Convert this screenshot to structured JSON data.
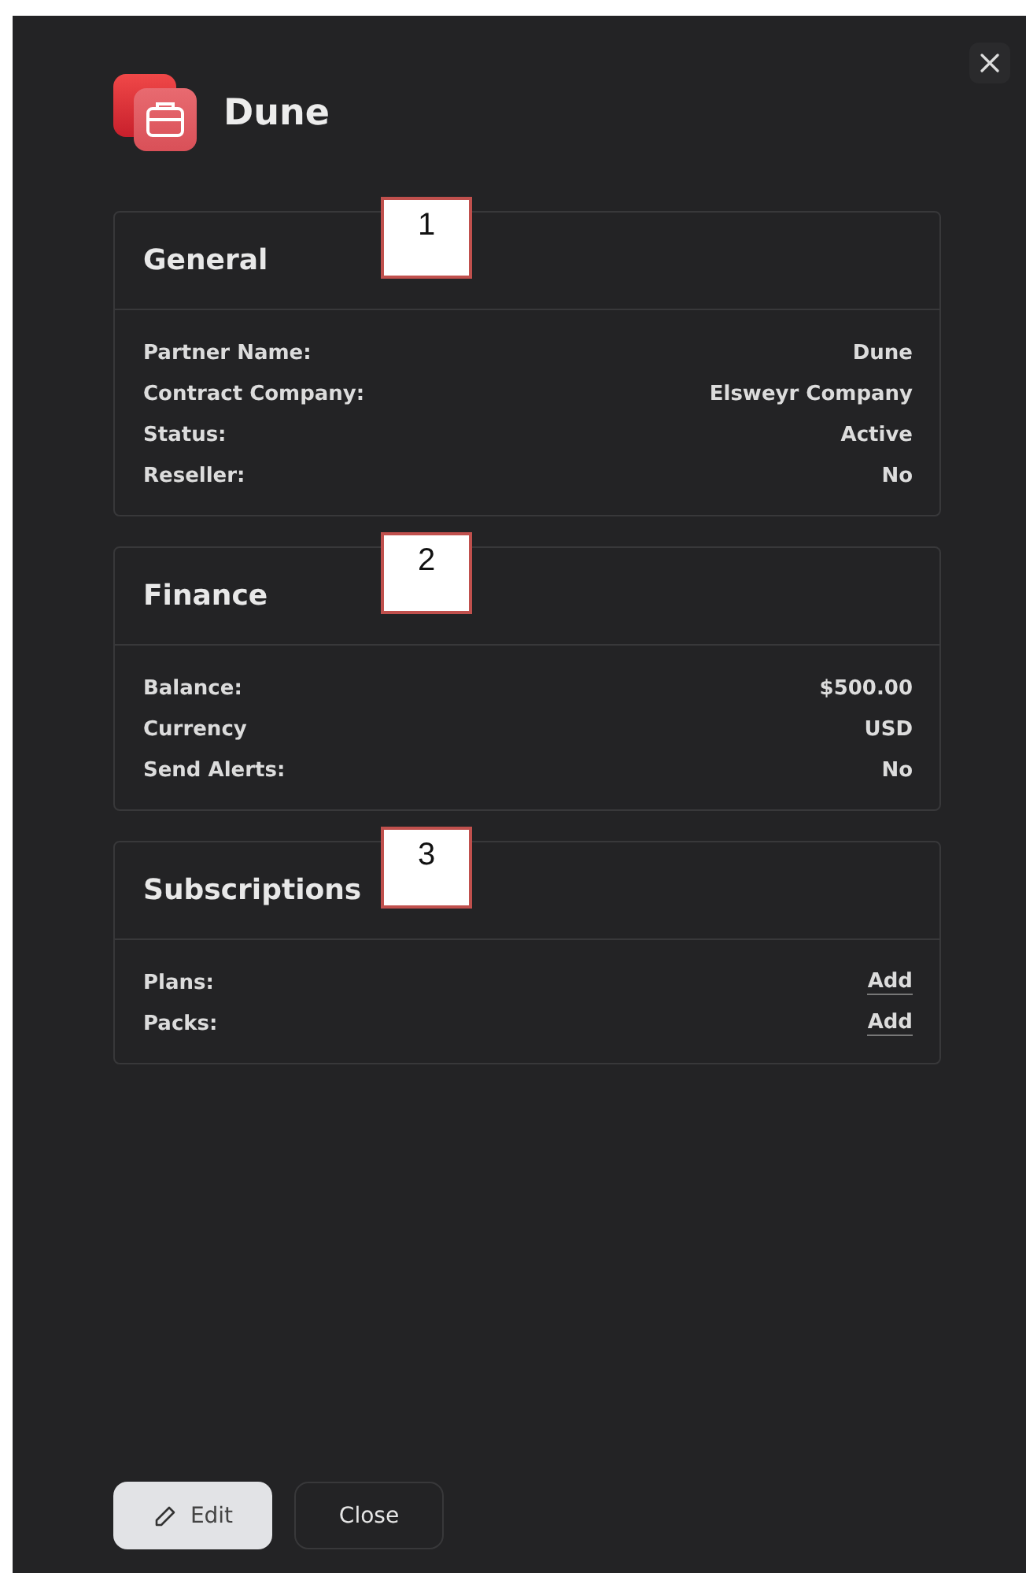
{
  "header": {
    "title": "Dune"
  },
  "sections": [
    {
      "title": "General",
      "callout": "1",
      "rows": [
        {
          "label": "Partner Name:",
          "value": "Dune",
          "kind": "text"
        },
        {
          "label": "Contract Company:",
          "value": "Elsweyr Company",
          "kind": "text"
        },
        {
          "label": "Status:",
          "value": "Active",
          "kind": "text"
        },
        {
          "label": "Reseller:",
          "value": "No",
          "kind": "text"
        }
      ]
    },
    {
      "title": "Finance",
      "callout": "2",
      "rows": [
        {
          "label": "Balance:",
          "value": "$500.00",
          "kind": "text"
        },
        {
          "label": "Currency",
          "value": "USD",
          "kind": "text"
        },
        {
          "label": "Send Alerts:",
          "value": "No",
          "kind": "text"
        }
      ]
    },
    {
      "title": "Subscriptions",
      "callout": "3",
      "rows": [
        {
          "label": "Plans:",
          "value": "Add",
          "kind": "link"
        },
        {
          "label": "Packs:",
          "value": "Add",
          "kind": "link"
        }
      ]
    }
  ],
  "buttons": [
    {
      "label": "Edit",
      "kind": "primary"
    },
    {
      "label": "Close",
      "kind": "secondary"
    }
  ]
}
